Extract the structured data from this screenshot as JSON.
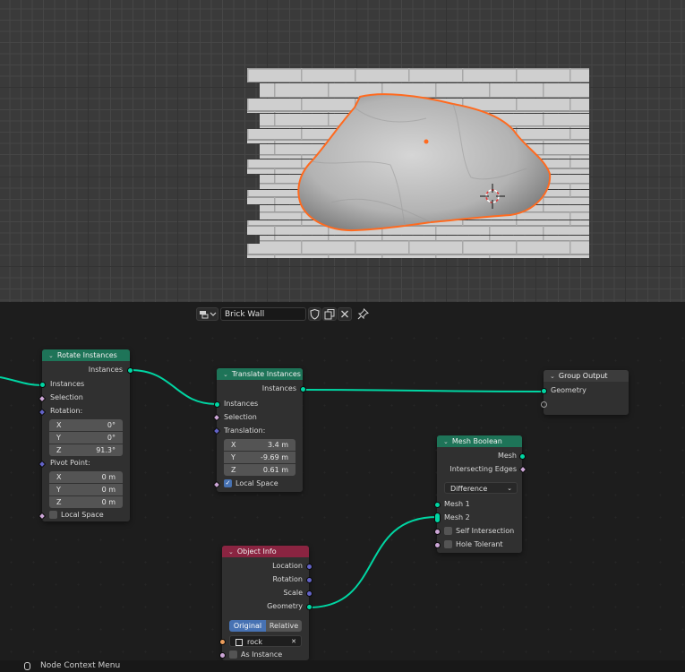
{
  "header": {
    "tree_name": "Brick Wall",
    "icons": [
      "editor-type-icon",
      "shield-icon",
      "duplicate-icon",
      "close-icon",
      "pin-icon"
    ]
  },
  "nodes": {
    "rotate_instances": {
      "title": "Rotate Instances",
      "out_instances": "Instances",
      "in_instances": "Instances",
      "selection": "Selection",
      "rotation": "Rotation:",
      "rx_label": "X",
      "rx_value": "0°",
      "ry_label": "Y",
      "ry_value": "0°",
      "rz_label": "Z",
      "rz_value": "91.3°",
      "pivot": "Pivot Point:",
      "px_label": "X",
      "px_value": "0 m",
      "py_label": "Y",
      "py_value": "0 m",
      "pz_label": "Z",
      "pz_value": "0 m",
      "local_space": "Local Space"
    },
    "translate_instances": {
      "title": "Translate Instances",
      "out_instances": "Instances",
      "in_instances": "Instances",
      "selection": "Selection",
      "translation": "Translation:",
      "x_label": "X",
      "x_value": "3.4 m",
      "y_label": "Y",
      "y_value": "-9.69 m",
      "z_label": "Z",
      "z_value": "0.61 m",
      "local_space": "Local Space"
    },
    "group_output": {
      "title": "Group Output",
      "geometry": "Geometry"
    },
    "mesh_boolean": {
      "title": "Mesh Boolean",
      "out_mesh": "Mesh",
      "intersecting_edges": "Intersecting Edges",
      "operation": "Difference",
      "mesh1": "Mesh 1",
      "mesh2": "Mesh 2",
      "self_intersection": "Self Intersection",
      "hole_tolerant": "Hole Tolerant"
    },
    "object_info": {
      "title": "Object Info",
      "location": "Location",
      "rotation": "Rotation",
      "scale": "Scale",
      "geometry": "Geometry",
      "mode_original": "Original",
      "mode_relative": "Relative",
      "object": "rock",
      "as_instance": "As Instance"
    }
  },
  "status_bar": {
    "hint": "Node Context Menu"
  },
  "colors": {
    "geometry_socket": "#00d6a3",
    "node_header_geometry": "#1e7458",
    "node_header_input": "#8a2441",
    "selection_outline": "#ff6a1f"
  }
}
